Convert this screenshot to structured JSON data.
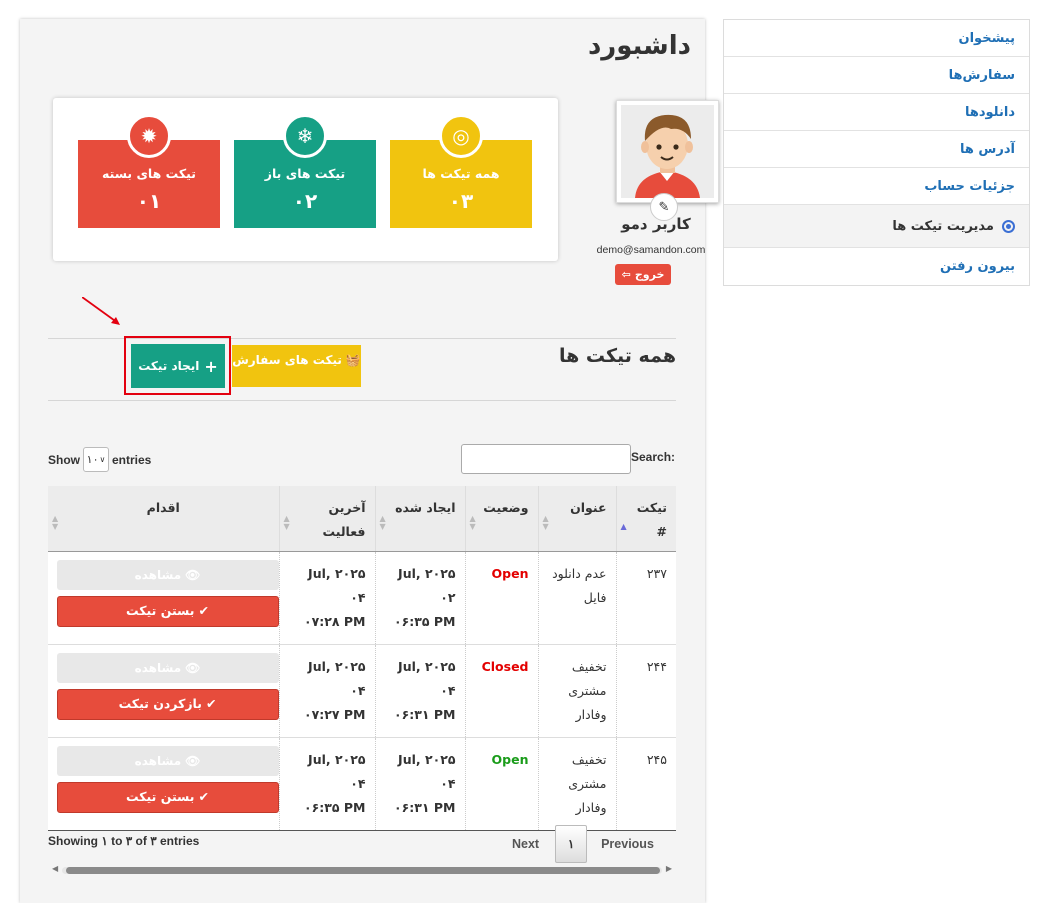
{
  "sidebar": {
    "items": [
      {
        "label": "پیشخوان"
      },
      {
        "label": "سفارش‌ها"
      },
      {
        "label": "دانلودها"
      },
      {
        "label": "آدرس ها"
      },
      {
        "label": "جزئیات حساب"
      },
      {
        "label": "مدیریت تیکت ها",
        "active": true
      },
      {
        "label": "بیرون رفتن"
      }
    ]
  },
  "page": {
    "title": "داشبورد"
  },
  "profile": {
    "name": "کاربر دمو",
    "email": "demo@samandon.com",
    "logout_label": "خروج"
  },
  "stats": [
    {
      "label": "همه تیکت ها",
      "value": "۰۳",
      "color": "#f1c40f",
      "icon": "target-icon"
    },
    {
      "label": "تیکت های باز",
      "value": "۰۲",
      "color": "#16a085",
      "icon": "snowflake-icon"
    },
    {
      "label": "تیکت های بسته",
      "value": "۰۱",
      "color": "#e74c3c",
      "icon": "gear-icon"
    }
  ],
  "section": {
    "title": "همه تیکت ها",
    "order_tickets_label": "تیکت های سفارش",
    "create_ticket_label": "ایجاد تیکت"
  },
  "table_controls": {
    "show_label": "Show",
    "length_value": "۱۰",
    "entries_label": "entries",
    "search_label": "Search:"
  },
  "table": {
    "headers": [
      "تیکت #",
      "عنوان",
      "وضعیت",
      "ایجاد شده",
      "آخرین فعالیت",
      "اقدام"
    ],
    "rows": [
      {
        "id": "۲۳۷",
        "title": "عدم دانلود فایل",
        "status": "Open",
        "status_color": "#e30000",
        "created_line1": "Jul, ۲۰۲۵ ۰۲",
        "created_line2": "۰۶:۳۵ PM",
        "activity_line1": "Jul, ۲۰۲۵ ۰۴",
        "activity_line2": "۰۷:۲۸ PM",
        "view_label": "مشاهده",
        "action_label": "بستن تیکت"
      },
      {
        "id": "۲۴۴",
        "title": "تخفیف مشتری وفادار",
        "status": "Closed",
        "status_color": "#e30000",
        "created_line1": "Jul, ۲۰۲۵ ۰۴",
        "created_line2": "۰۶:۳۱ PM",
        "activity_line1": "Jul, ۲۰۲۵ ۰۴",
        "activity_line2": "۰۷:۲۷ PM",
        "view_label": "مشاهده",
        "action_label": "بازکردن تیکت"
      },
      {
        "id": "۲۴۵",
        "title": "تخفیف مشتری وفادار",
        "status": "Open",
        "status_color": "#1a9c1a",
        "created_line1": "Jul, ۲۰۲۵ ۰۴",
        "created_line2": "۰۶:۳۱ PM",
        "activity_line1": "Jul, ۲۰۲۵ ۰۴",
        "activity_line2": "۰۶:۳۵ PM",
        "view_label": "مشاهده",
        "action_label": "بستن تیکت"
      }
    ]
  },
  "footer": {
    "info": "Showing ۱ to ۳ of ۳ entries",
    "previous_label": "Previous",
    "page_number": "۱",
    "next_label": "Next"
  }
}
